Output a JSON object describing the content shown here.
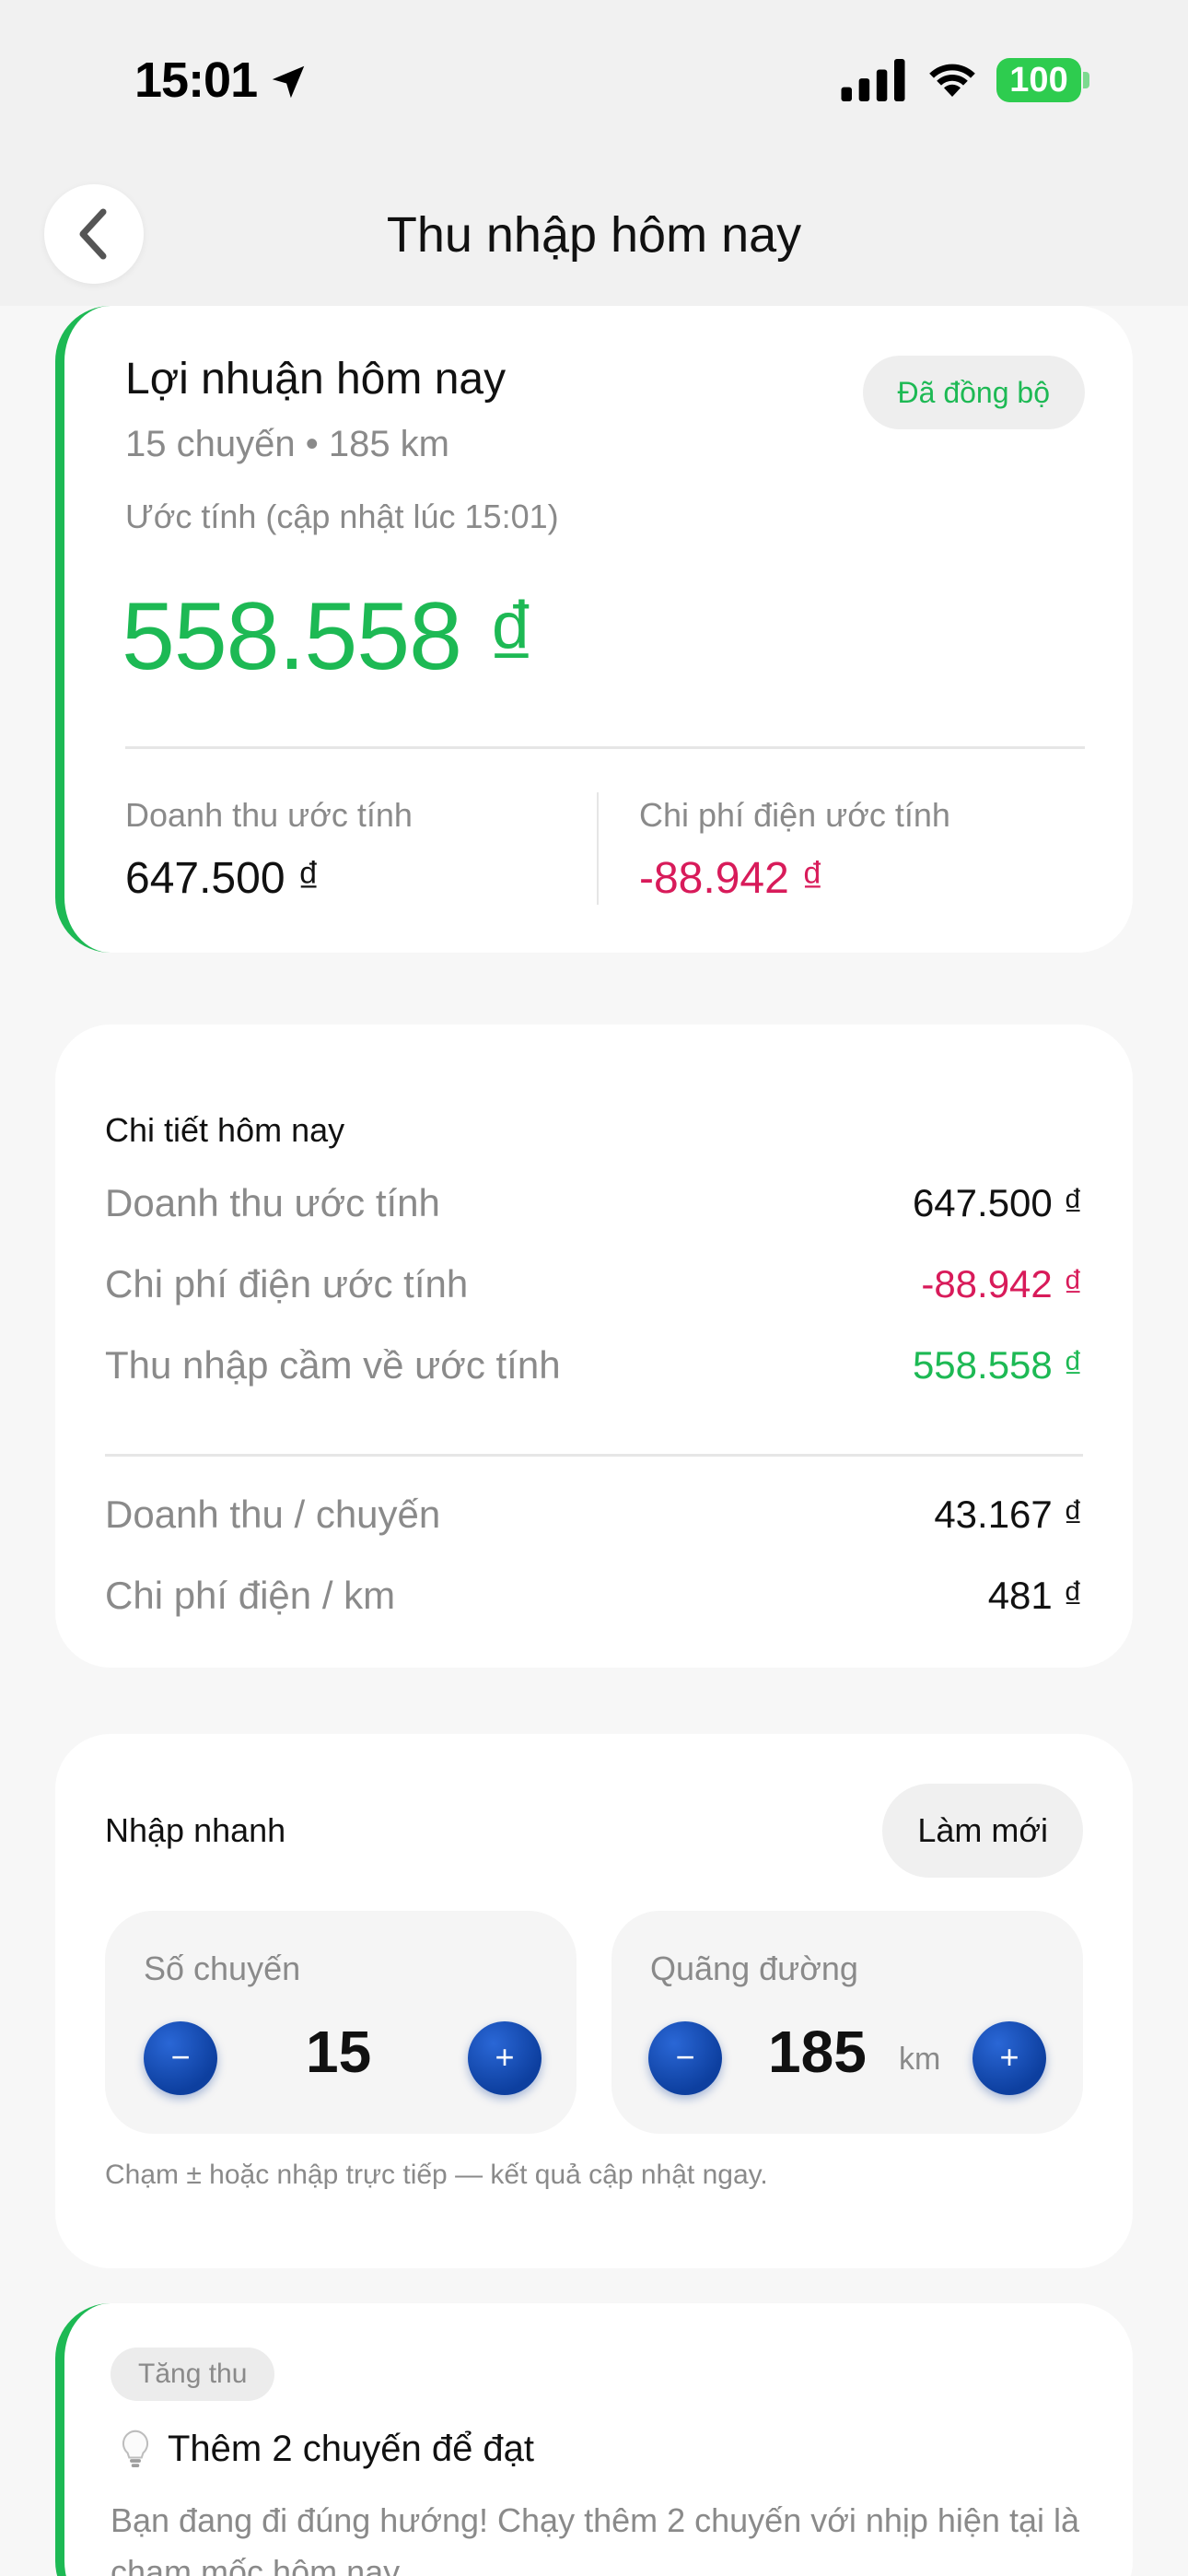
{
  "status_bar": {
    "time": "15:01",
    "battery": "100"
  },
  "nav": {
    "title": "Thu nhập hôm nay"
  },
  "profit_card": {
    "title": "Lợi nhuận hôm nay",
    "subtitle": "15 chuyến • 185 km",
    "updated": "Ước tính (cập nhật lúc 15:01)",
    "sync_badge": "Đã đồng bộ",
    "value": "558.558 ₫",
    "revenue_label": "Doanh thu ước tính",
    "revenue_value": "647.500 ₫",
    "cost_label": "Chi phí điện ước tính",
    "cost_value": "-88.942 ₫"
  },
  "details": {
    "title": "Chi tiết hôm nay",
    "rows": [
      {
        "label": "Doanh thu ước tính",
        "value": "647.500 ₫"
      },
      {
        "label": "Chi phí điện ước tính",
        "value": "-88.942 ₫"
      },
      {
        "label": "Thu nhập cầm về ước tính",
        "value": "558.558 ₫"
      }
    ],
    "rows2": [
      {
        "label": "Doanh thu / chuyến",
        "value": "43.167 ₫"
      },
      {
        "label": "Chi phí điện / km",
        "value": "481 ₫"
      }
    ]
  },
  "quick_input": {
    "title": "Nhập nhanh",
    "refresh_label": "Làm mới",
    "trips": {
      "label": "Số chuyến",
      "value": "15",
      "minus": "−",
      "plus": "+"
    },
    "distance": {
      "label": "Quãng đường",
      "value": "185",
      "unit": "km",
      "minus": "−",
      "plus": "+"
    },
    "hint": "Chạm ± hoặc nhập trực tiếp — kết quả cập nhật ngay."
  },
  "tip": {
    "badge": "Tăng thu",
    "title": "Thêm 2 chuyến để đạt",
    "body": "Bạn đang đi đúng hướng! Chạy thêm 2 chuyến với nhịp hiện tại là chạm mốc hôm nay."
  },
  "colors": {
    "green": "#1db954",
    "red": "#d81b5a",
    "blue": "#0d3f9f"
  }
}
